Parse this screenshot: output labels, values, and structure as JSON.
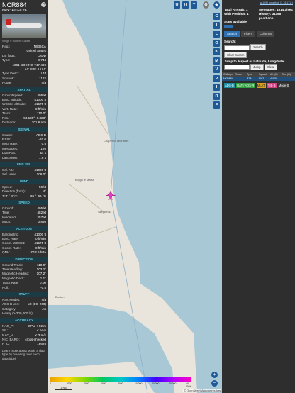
{
  "detail": {
    "callsign": "NCR884",
    "hex_line": "Hex: ACFC26",
    "image_credit": "Image © Roberto Cassar",
    "reg_rows": [
      {
        "k": "Reg.:",
        "v": "N936CA"
      },
      {
        "k": "",
        "v": "United States"
      },
      {
        "k": "DB flags:",
        "v": "LADD"
      },
      {
        "k": "Type:",
        "v": "B744"
      },
      {
        "k": "",
        "v": "1991 BOEING 747-400"
      },
      {
        "k": "",
        "v": "AC SPE II LLC"
      },
      {
        "k": "Type Desc.:",
        "v": "L4J"
      },
      {
        "k": "Squawk:",
        "v": "1162"
      },
      {
        "k": "Route:",
        "v": "n/a"
      }
    ],
    "sections": [
      {
        "title": "SPATIAL",
        "rows": [
          {
            "k": "Groundspeed:",
            "v": "495 kt"
          },
          {
            "k": "Baro. altitude:",
            "v": "41000 ft"
          },
          {
            "k": "WGS84 altitude:",
            "v": "41575 ft"
          },
          {
            "k": "Vert. Rate:",
            "v": "0 ft/min"
          },
          {
            "k": "Track:",
            "v": "110.0°"
          },
          {
            "k": "Pos.:",
            "v": "53.135°, 0.328°"
          },
          {
            "k": "Distance:",
            "v": "201.6 nmi"
          }
        ]
      },
      {
        "title": "SIGNAL",
        "rows": [
          {
            "k": "Source:",
            "v": "ADS-B"
          },
          {
            "k": "RSSI:",
            "v": "-20.0"
          },
          {
            "k": "Msg. Rate:",
            "v": "0.5"
          },
          {
            "k": "Messages:",
            "v": "120"
          },
          {
            "k": "Last Pos.:",
            "v": "11 s"
          },
          {
            "k": "Last Seen:",
            "v": "1.6 s"
          }
        ]
      },
      {
        "title": "FMS SEL",
        "rows": [
          {
            "k": "Sel. Alt.:",
            "v": "41008 ft"
          },
          {
            "k": "Sel. Head.:",
            "v": "109.0°"
          }
        ]
      },
      {
        "title": "WIND",
        "rows": [
          {
            "k": "Speed:",
            "v": "59 kt"
          },
          {
            "k": "Direction (from):",
            "v": "4°"
          },
          {
            "k": "TAT / OAT:",
            "v": "-36 / -66 °C"
          }
        ]
      },
      {
        "title": "SPEED",
        "rows": [
          {
            "k": "Ground:",
            "v": "495 kt"
          },
          {
            "k": "True:",
            "v": "482 kt"
          },
          {
            "k": "Indicated:",
            "v": "257 kt"
          },
          {
            "k": "Mach:",
            "v": "0.860"
          }
        ]
      },
      {
        "title": "ALTITUDE",
        "rows": [
          {
            "k": "Barometric:",
            "v": "41000 ft"
          },
          {
            "k": "Baro. Rate:",
            "v": "0 ft/min"
          },
          {
            "k": "Geom. WGS84:",
            "v": "41575 ft"
          },
          {
            "k": "Geom. Rate:",
            "v": "0 ft/min"
          },
          {
            "k": "QNH:",
            "v": "1013.6 hPa"
          }
        ]
      },
      {
        "title": "DIRECTION",
        "rows": [
          {
            "k": "Ground Track:",
            "v": "110.0°"
          },
          {
            "k": "True Heading:",
            "v": "103.2°"
          },
          {
            "k": "Magnetic Heading:",
            "v": "107.2°"
          },
          {
            "k": "Magnetic Decl.:",
            "v": "1.1°"
          },
          {
            "k": "Track Rate:",
            "v": "0.00"
          },
          {
            "k": "Roll:",
            "v": "-0.5"
          }
        ]
      },
      {
        "title": "STUFF",
        "rows": [
          {
            "k": "Nav. Modes:",
            "v": "n/a"
          },
          {
            "k": "ADS-B Ver.:",
            "v": "v0 (DO-260)"
          },
          {
            "k": "Category:",
            "v": "A5"
          },
          {
            "k": "Heavy (> 300,000 lb)",
            "v": ""
          }
        ]
      },
      {
        "title": "ACCURACY",
        "rows": [
          {
            "k": "NAC_P:",
            "v": "EPU < 92 m"
          },
          {
            "k": "SIL:",
            "v": "≤ 1e-5"
          },
          {
            "k": "NAC_V:",
            "v": "< 3 m/s"
          },
          {
            "k": "NIC_BARO:",
            "v": "cross-checked"
          },
          {
            "k": "R_C:",
            "v": "186 m"
          }
        ]
      }
    ],
    "footer": "Learn more about Mode S data type by hovering over each data label."
  },
  "map": {
    "toolbar_top": [
      "U",
      "H",
      "T"
    ],
    "toolbar_side": [
      "C",
      "I",
      "L",
      "O",
      "K",
      "M",
      "V",
      "P",
      "I",
      "R",
      "F"
    ],
    "labels": [
      "Chapel St Leonards",
      "Burgh le Marsh",
      "Skegness",
      "Boston"
    ],
    "scale_label": "1 NM",
    "legend_ticks": [
      "0",
      "2000",
      "4000",
      "6000",
      "8000",
      "10 000",
      "20 000",
      "30 000",
      "40 000+"
    ],
    "attribution": "© OpenStreetMap contributors",
    "zoom_in": "+",
    "zoom_out": "−",
    "colors": {
      "sea": "#a9c8d6",
      "land": "#e9e5dc",
      "aircraft": "#e040c0"
    }
  },
  "stats": {
    "github_link": "tar1090 on github (3.14.1711)",
    "rows": [
      {
        "k": "Total Aircraft: 1",
        "v": "Messages: 1514.1/sec"
      },
      {
        "k": "With Position: 1",
        "v": "History: 31196 positions"
      }
    ],
    "stats_available": "Stats available",
    "tabs": [
      "Search",
      "Filters",
      "Columns"
    ],
    "search_label": "Search:",
    "search_button": "Search",
    "clear_search": "Clear Search",
    "jump_label": "Jump to Airport or Latitude, Longitude:",
    "jump_button": "Jump",
    "clear_button": "Clear",
    "table_headers": [
      "Callsign",
      "Route",
      "Type",
      "Squawk",
      "Alt. (ft)",
      "Spd (kt)"
    ],
    "table_row": [
      "NCR884",
      "",
      "B744",
      "1162",
      "41000",
      ""
    ],
    "badges": [
      "ADS-B",
      "UAT / ADS-R",
      "MLAT",
      "TIS-B",
      "Mode-S"
    ]
  }
}
